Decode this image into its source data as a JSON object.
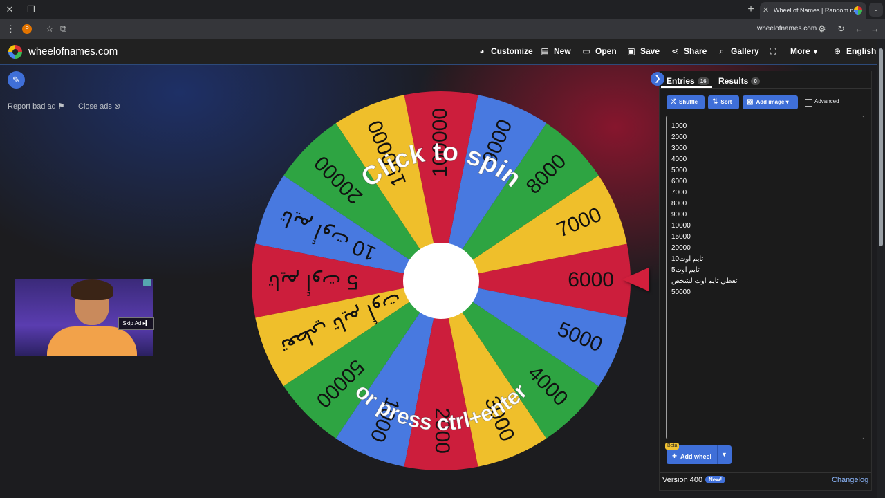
{
  "browser": {
    "tab_title": "Wheel of Names | Random nam",
    "url": "wheelofnames.com"
  },
  "site": {
    "brand": "wheelofnames.com",
    "nav": [
      {
        "label": "Customize",
        "icon": "palette-icon"
      },
      {
        "label": "New",
        "icon": "file-icon"
      },
      {
        "label": "Open",
        "icon": "folder-open-icon"
      },
      {
        "label": "Save",
        "icon": "save-icon"
      },
      {
        "label": "Share",
        "icon": "share-icon"
      },
      {
        "label": "Gallery",
        "icon": "search-icon"
      },
      {
        "label": "More",
        "icon": "fullscreen-icon"
      },
      {
        "label": "English",
        "icon": "globe-icon"
      }
    ]
  },
  "ads": {
    "report": "Report bad ad",
    "close": "Close ads",
    "skip": "Skip Ad"
  },
  "wheel": {
    "top_text": "Click to spin",
    "bottom_text": "or press ctrl+enter",
    "segments": [
      "6000",
      "7000",
      "8000",
      "9000",
      "100000",
      "150000",
      "20000",
      "10 تايم أوت",
      "5 تايم أوت",
      "تعطي تايم أوت لشخص",
      "50000",
      "1000",
      "2000",
      "3000",
      "4000",
      "5000"
    ],
    "colors": {
      "red": "#cc1e3c",
      "yellow": "#efbf2b",
      "green": "#2ea442",
      "blue": "#4879e0"
    }
  },
  "panel": {
    "entries_tab": "Entries",
    "entries_count": "16",
    "results_tab": "Results",
    "results_count": "0",
    "shuffle": "Shuffle",
    "sort": "Sort",
    "add_image": "Add image",
    "advanced": "Advanced",
    "entries": [
      "1000",
      "2000",
      "3000",
      "4000",
      "5000",
      "6000",
      "7000",
      "8000",
      "9000",
      "10000",
      "15000",
      "20000",
      "10تايم اوت",
      "تايم اوت5",
      "تعطي تايم اوت لشخص",
      "50000"
    ],
    "beta": "Beta",
    "add_wheel": "Add wheel",
    "version": "Version 400",
    "new_badge": "New!",
    "changelog": "Changelog"
  }
}
